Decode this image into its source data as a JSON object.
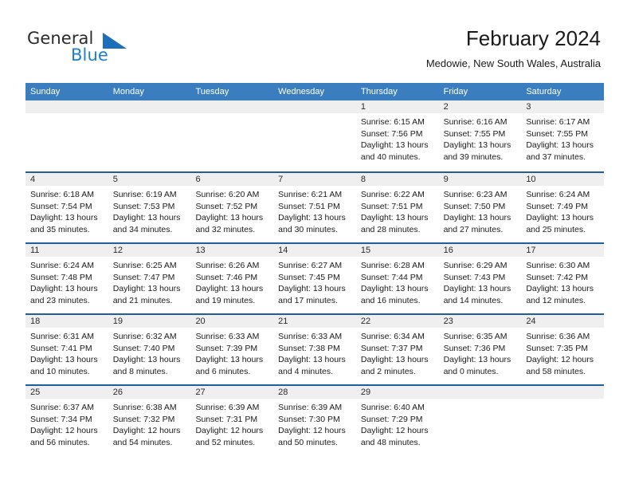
{
  "brand": {
    "name_top": "General",
    "name_bottom": "Blue",
    "flag_icon": "triangle-flag-icon",
    "top_color": "#2b2b2b",
    "bottom_color": "#1c7fd4"
  },
  "header": {
    "title": "February 2024",
    "subtitle": "Medowie, New South Wales, Australia"
  },
  "colors": {
    "header_blue": "#3a7ebf",
    "row_separator_blue": "#1f5fa0",
    "day_band_gray": "#efefef",
    "cell_white": "#ffffff",
    "text": "#1a1a1a"
  },
  "weekdays": [
    "Sunday",
    "Monday",
    "Tuesday",
    "Wednesday",
    "Thursday",
    "Friday",
    "Saturday"
  ],
  "weeks": [
    [
      {
        "day": "",
        "lines": []
      },
      {
        "day": "",
        "lines": []
      },
      {
        "day": "",
        "lines": []
      },
      {
        "day": "",
        "lines": []
      },
      {
        "day": "1",
        "lines": [
          "Sunrise: 6:15 AM",
          "Sunset: 7:56 PM",
          "Daylight: 13 hours",
          "and 40 minutes."
        ]
      },
      {
        "day": "2",
        "lines": [
          "Sunrise: 6:16 AM",
          "Sunset: 7:55 PM",
          "Daylight: 13 hours",
          "and 39 minutes."
        ]
      },
      {
        "day": "3",
        "lines": [
          "Sunrise: 6:17 AM",
          "Sunset: 7:55 PM",
          "Daylight: 13 hours",
          "and 37 minutes."
        ]
      }
    ],
    [
      {
        "day": "4",
        "lines": [
          "Sunrise: 6:18 AM",
          "Sunset: 7:54 PM",
          "Daylight: 13 hours",
          "and 35 minutes."
        ]
      },
      {
        "day": "5",
        "lines": [
          "Sunrise: 6:19 AM",
          "Sunset: 7:53 PM",
          "Daylight: 13 hours",
          "and 34 minutes."
        ]
      },
      {
        "day": "6",
        "lines": [
          "Sunrise: 6:20 AM",
          "Sunset: 7:52 PM",
          "Daylight: 13 hours",
          "and 32 minutes."
        ]
      },
      {
        "day": "7",
        "lines": [
          "Sunrise: 6:21 AM",
          "Sunset: 7:51 PM",
          "Daylight: 13 hours",
          "and 30 minutes."
        ]
      },
      {
        "day": "8",
        "lines": [
          "Sunrise: 6:22 AM",
          "Sunset: 7:51 PM",
          "Daylight: 13 hours",
          "and 28 minutes."
        ]
      },
      {
        "day": "9",
        "lines": [
          "Sunrise: 6:23 AM",
          "Sunset: 7:50 PM",
          "Daylight: 13 hours",
          "and 27 minutes."
        ]
      },
      {
        "day": "10",
        "lines": [
          "Sunrise: 6:24 AM",
          "Sunset: 7:49 PM",
          "Daylight: 13 hours",
          "and 25 minutes."
        ]
      }
    ],
    [
      {
        "day": "11",
        "lines": [
          "Sunrise: 6:24 AM",
          "Sunset: 7:48 PM",
          "Daylight: 13 hours",
          "and 23 minutes."
        ]
      },
      {
        "day": "12",
        "lines": [
          "Sunrise: 6:25 AM",
          "Sunset: 7:47 PM",
          "Daylight: 13 hours",
          "and 21 minutes."
        ]
      },
      {
        "day": "13",
        "lines": [
          "Sunrise: 6:26 AM",
          "Sunset: 7:46 PM",
          "Daylight: 13 hours",
          "and 19 minutes."
        ]
      },
      {
        "day": "14",
        "lines": [
          "Sunrise: 6:27 AM",
          "Sunset: 7:45 PM",
          "Daylight: 13 hours",
          "and 17 minutes."
        ]
      },
      {
        "day": "15",
        "lines": [
          "Sunrise: 6:28 AM",
          "Sunset: 7:44 PM",
          "Daylight: 13 hours",
          "and 16 minutes."
        ]
      },
      {
        "day": "16",
        "lines": [
          "Sunrise: 6:29 AM",
          "Sunset: 7:43 PM",
          "Daylight: 13 hours",
          "and 14 minutes."
        ]
      },
      {
        "day": "17",
        "lines": [
          "Sunrise: 6:30 AM",
          "Sunset: 7:42 PM",
          "Daylight: 13 hours",
          "and 12 minutes."
        ]
      }
    ],
    [
      {
        "day": "18",
        "lines": [
          "Sunrise: 6:31 AM",
          "Sunset: 7:41 PM",
          "Daylight: 13 hours",
          "and 10 minutes."
        ]
      },
      {
        "day": "19",
        "lines": [
          "Sunrise: 6:32 AM",
          "Sunset: 7:40 PM",
          "Daylight: 13 hours",
          "and 8 minutes."
        ]
      },
      {
        "day": "20",
        "lines": [
          "Sunrise: 6:33 AM",
          "Sunset: 7:39 PM",
          "Daylight: 13 hours",
          "and 6 minutes."
        ]
      },
      {
        "day": "21",
        "lines": [
          "Sunrise: 6:33 AM",
          "Sunset: 7:38 PM",
          "Daylight: 13 hours",
          "and 4 minutes."
        ]
      },
      {
        "day": "22",
        "lines": [
          "Sunrise: 6:34 AM",
          "Sunset: 7:37 PM",
          "Daylight: 13 hours",
          "and 2 minutes."
        ]
      },
      {
        "day": "23",
        "lines": [
          "Sunrise: 6:35 AM",
          "Sunset: 7:36 PM",
          "Daylight: 13 hours",
          "and 0 minutes."
        ]
      },
      {
        "day": "24",
        "lines": [
          "Sunrise: 6:36 AM",
          "Sunset: 7:35 PM",
          "Daylight: 12 hours",
          "and 58 minutes."
        ]
      }
    ],
    [
      {
        "day": "25",
        "lines": [
          "Sunrise: 6:37 AM",
          "Sunset: 7:34 PM",
          "Daylight: 12 hours",
          "and 56 minutes."
        ]
      },
      {
        "day": "26",
        "lines": [
          "Sunrise: 6:38 AM",
          "Sunset: 7:32 PM",
          "Daylight: 12 hours",
          "and 54 minutes."
        ]
      },
      {
        "day": "27",
        "lines": [
          "Sunrise: 6:39 AM",
          "Sunset: 7:31 PM",
          "Daylight: 12 hours",
          "and 52 minutes."
        ]
      },
      {
        "day": "28",
        "lines": [
          "Sunrise: 6:39 AM",
          "Sunset: 7:30 PM",
          "Daylight: 12 hours",
          "and 50 minutes."
        ]
      },
      {
        "day": "29",
        "lines": [
          "Sunrise: 6:40 AM",
          "Sunset: 7:29 PM",
          "Daylight: 12 hours",
          "and 48 minutes."
        ]
      },
      {
        "day": "",
        "lines": []
      },
      {
        "day": "",
        "lines": []
      }
    ]
  ]
}
